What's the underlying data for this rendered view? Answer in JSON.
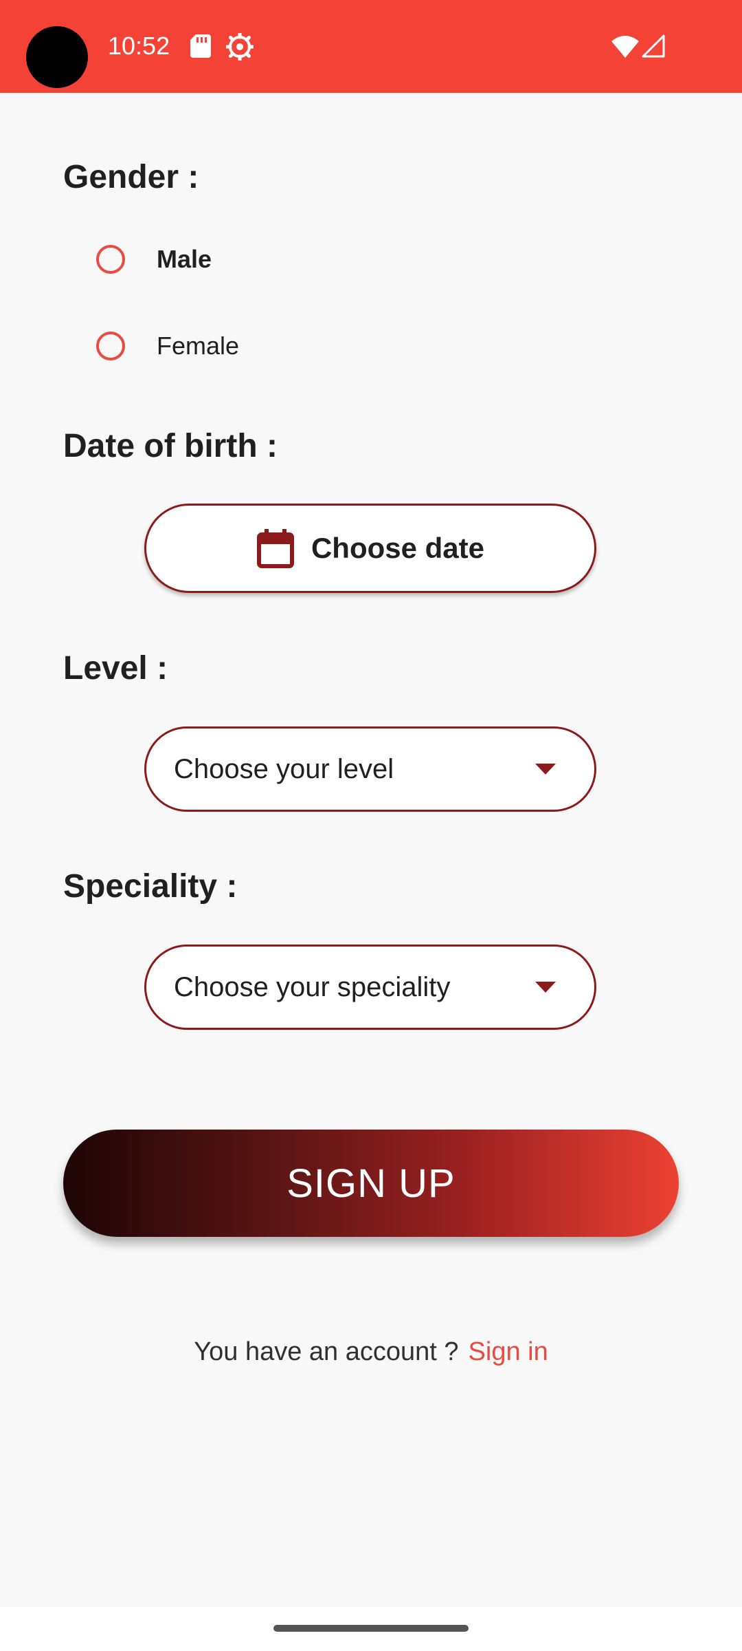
{
  "status_bar": {
    "time": "10:52",
    "icons": [
      "sd-card-icon",
      "settings-icon",
      "wifi-icon",
      "signal-icon"
    ],
    "background_color": "#F44336"
  },
  "gender": {
    "heading": "Gender :",
    "options": [
      {
        "label": "Male",
        "selected": false
      },
      {
        "label": "Female",
        "selected": false
      }
    ]
  },
  "date_of_birth": {
    "heading": "Date of birth :",
    "button_label": "Choose date",
    "icon": "calendar-icon"
  },
  "level": {
    "heading": "Level :",
    "placeholder": "Choose your level",
    "icon": "caret-down-icon"
  },
  "speciality": {
    "heading": "Speciality :",
    "placeholder": "Choose your speciality",
    "icon": "caret-down-icon"
  },
  "signup_button": {
    "label": "SIGN UP"
  },
  "account": {
    "prompt": "You have an account ?",
    "link": "Sign in"
  },
  "colors": {
    "accent": "#E84B3F",
    "border": "#8B1A1A",
    "gradient_start": "#1E0505",
    "gradient_end": "#EC4133"
  }
}
